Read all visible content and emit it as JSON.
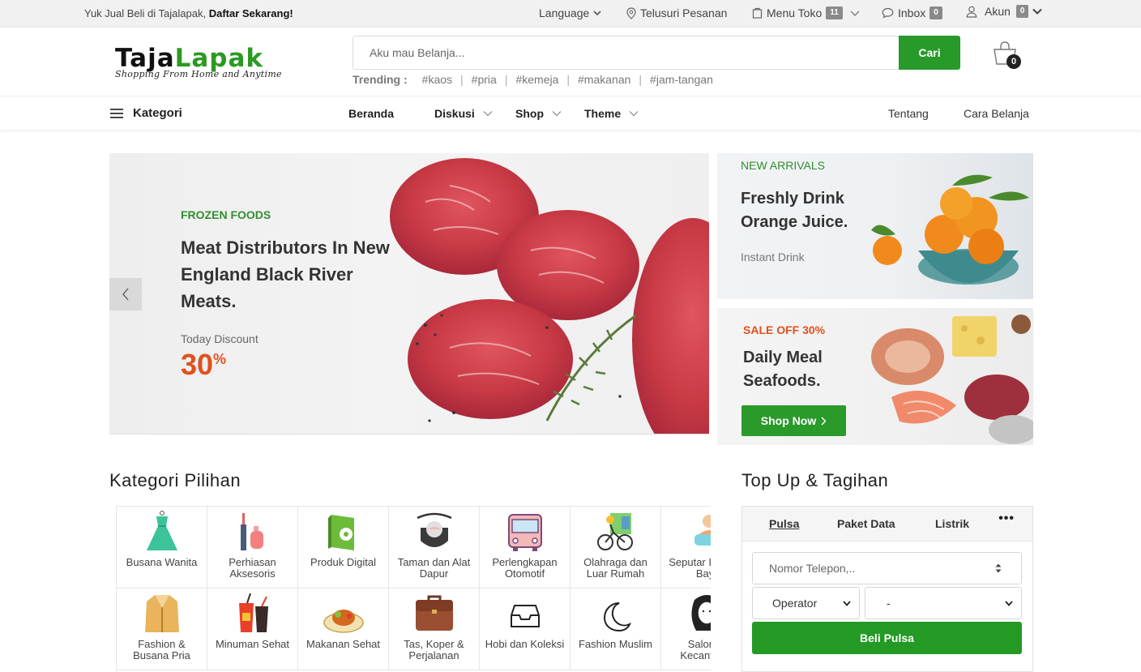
{
  "topbar": {
    "welcome_text": "Yuk Jual Beli di Tajalapak, ",
    "welcome_link": "Daftar Sekarang!",
    "language": "Language",
    "track_order": "Telusuri Pesanan",
    "store_menu": "Menu Toko",
    "store_count": "11",
    "inbox": "Inbox",
    "inbox_count": "0",
    "account": "Akun",
    "account_count": "0"
  },
  "header": {
    "logo_part1": "Taja",
    "logo_part2": "Lapak",
    "tagline": "Shopping From Home and Anytime",
    "search_placeholder": "Aku mau Belanja...",
    "search_button": "Cari",
    "trending_label": "Trending :",
    "trending_tags": [
      "#kaos",
      "#pria",
      "#kemeja",
      "#makanan",
      "#jam-tangan"
    ],
    "cart_count": "0"
  },
  "nav": {
    "category": "Kategori",
    "items": [
      "Beranda",
      "Diskusi",
      "Shop",
      "Theme"
    ],
    "right_items": [
      "Tentang",
      "Cara Belanja"
    ]
  },
  "hero": {
    "tag": "FROZEN FOODS",
    "title": "Meat Distributors In New England Black River Meats.",
    "discount_label": "Today Discount",
    "discount_value": "30",
    "discount_unit": "%"
  },
  "side_banner_1": {
    "tag": "NEW ARRIVALS",
    "title": "Freshly Drink Orange Juice.",
    "subtitle": "Instant Drink"
  },
  "side_banner_2": {
    "tag": "SALE OFF 30%",
    "title": "Daily Meal Seafoods.",
    "button": "Shop Now"
  },
  "categories": {
    "title": "Kategori Pilihan",
    "items": [
      "Busana Wanita",
      "Perhiasan Aksesoris",
      "Produk Digital",
      "Taman dan Alat Dapur",
      "Perlengkapan Otomotif",
      "Olahraga dan Luar Rumah",
      "Seputar Ibu dan Bayi",
      "Fashion & Busana Pria",
      "Minuman Sehat",
      "Makanan Sehat",
      "Tas, Koper & Perjalanan",
      "Hobi dan Koleksi",
      "Fashion Muslim",
      "Salon & Kecantikan"
    ]
  },
  "topup": {
    "title": "Top Up & Tagihan",
    "tabs": [
      "Pulsa",
      "Paket Data",
      "Listrik"
    ],
    "more": "•••",
    "phone_placeholder": "Nomor Telepon,..",
    "operator": "Operator",
    "nominal": "-",
    "buy_button": "Beli Pulsa"
  },
  "colors": {
    "brand_green": "#279a2a",
    "accent_orange": "#e0511d"
  }
}
